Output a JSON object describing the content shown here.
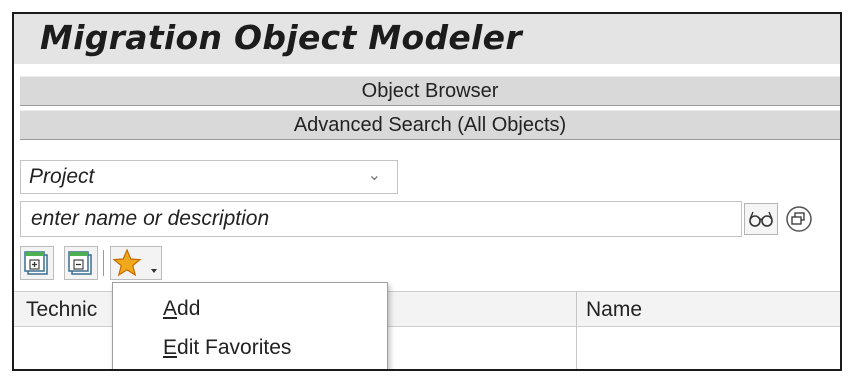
{
  "app": {
    "title": "Migration Object Modeler"
  },
  "panels": {
    "object_browser": "Object Browser",
    "advanced_search": "Advanced Search (All Objects)"
  },
  "filter": {
    "type_value": "Project"
  },
  "search": {
    "placeholder": "enter name or description"
  },
  "toolbar": {
    "icons": [
      "expand-all-icon",
      "collapse-all-icon",
      "favorites-star-icon"
    ]
  },
  "table": {
    "columns": [
      "Technical Name",
      "Name"
    ],
    "technical_visible": "Technic"
  },
  "favorites_menu": {
    "items": [
      {
        "mnemonic": "A",
        "rest": "dd"
      },
      {
        "mnemonic": "E",
        "rest": "dit Favorites"
      }
    ]
  },
  "colors": {
    "title_bar": "#e4e4e4",
    "panel_bar": "#d9d9d9",
    "star": "#f2a81d"
  }
}
